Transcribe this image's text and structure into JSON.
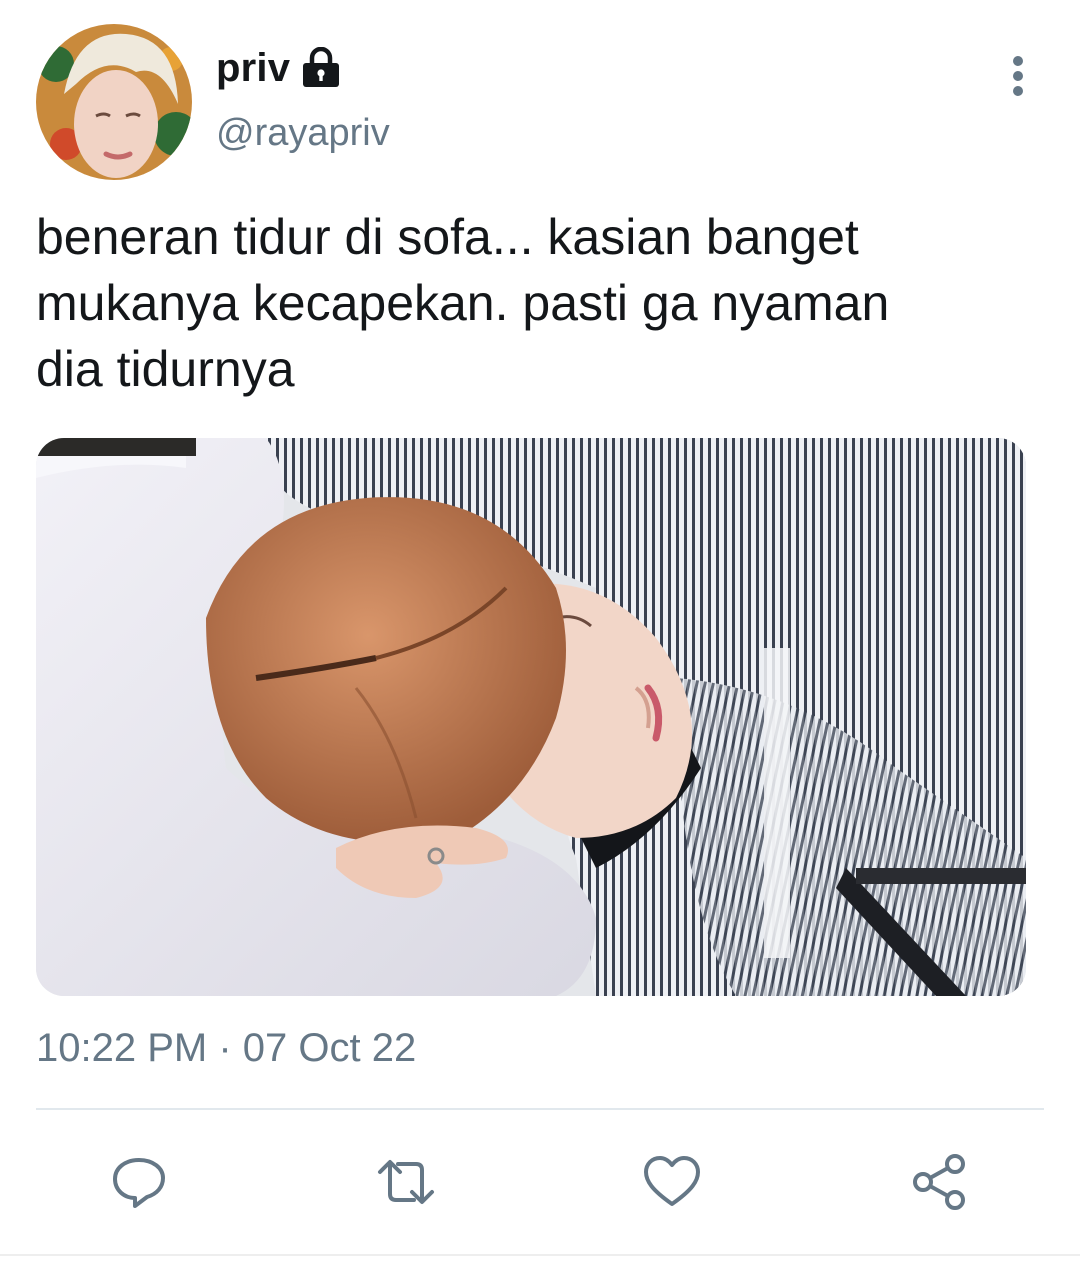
{
  "tweet": {
    "display_name": "priv",
    "handle": "@rayapriv",
    "text": "beneran tidur di sofa... kasian banget\nmukanya kecapekan. pasti ga nyaman\ndia tidurnya",
    "timestamp": "10:22 PM · 07 Oct 22",
    "protected": true
  },
  "icons": {
    "lock": "lock-icon",
    "more": "more-vertical-icon",
    "reply": "reply-icon",
    "retweet": "retweet-icon",
    "like": "heart-icon",
    "share": "share-icon"
  },
  "colors": {
    "text_primary": "#14171a",
    "text_secondary": "#657786",
    "icon": "#657786",
    "divider": "#e1e8ed"
  }
}
